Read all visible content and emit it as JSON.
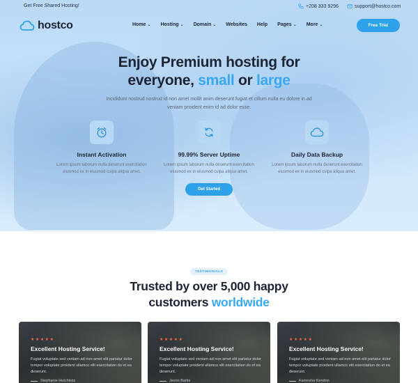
{
  "topbar": {
    "promo": "Get Free Shared Hosting!",
    "phone": "+208 333 9296",
    "email": "support@hostco.com"
  },
  "brand": {
    "name": "hostco",
    "logo_icon": "cloud-icon"
  },
  "nav": {
    "items": [
      {
        "label": "Home",
        "has_dropdown": true
      },
      {
        "label": "Hosting",
        "has_dropdown": true
      },
      {
        "label": "Domain",
        "has_dropdown": true
      },
      {
        "label": "Websites",
        "has_dropdown": false
      },
      {
        "label": "Help",
        "has_dropdown": false
      },
      {
        "label": "Pages",
        "has_dropdown": true
      },
      {
        "label": "More",
        "has_dropdown": true
      }
    ],
    "cta": "Free Trial"
  },
  "hero": {
    "title_line1": "Enjoy Premium hosting for",
    "title_line2_a": "everyone,",
    "title_line2_b": "small",
    "title_line2_c": "or",
    "title_line2_d": "large",
    "subtitle": "Incididunt nostrud nostrud id non amet mollit anim deserunt fugiat et cillum nulla eu dolore in ad veniam proident enim id ad dolor esse.",
    "features": [
      {
        "icon": "clock-icon",
        "title": "Instant Activation",
        "desc": "Lorem ipsum laborum nulla deserunt exercitation eiusmod ex in eiusmod culpa aliqua amet."
      },
      {
        "icon": "refresh-icon",
        "title": "99.99% Server Uptime",
        "desc": "Lorem ipsum laborum nulla deserunt exercitation eiusmod ex in eiusmod culpa aliqua amet."
      },
      {
        "icon": "cloud-icon",
        "title": "Daily Data Backup",
        "desc": "Lorem ipsum laborum nulla deserunt exercitation eiusmod ex in eiusmod culpa aliqua amet."
      }
    ],
    "cta": "Get Started"
  },
  "testimonials": {
    "tag": "TESTIMONIALS",
    "title_line1": "Trusted by over 5,000 happy",
    "title_line2_a": "customers",
    "title_line2_b": "worldwide",
    "cards": [
      {
        "stars": "★★★★★",
        "title": "Excellent Hosting Service!",
        "text": "Fugiat voluptate sed veniam ad non amet elit pariatur dolor tempor voluptate proident ullamco elit exercitation do et ea deserunt.",
        "author": "Stephanie Hutchkiss"
      },
      {
        "stars": "★★★★★",
        "title": "Excellent Hosting Service!",
        "text": "Fugiat voluptate sed veniam ad non amet elit pariatur dolor tempor voluptate proident ullamco elit exercitation do et ea deserunt.",
        "author": "Jevon Barks"
      },
      {
        "stars": "★★★★★",
        "title": "Excellent Hosting Service!",
        "text": "Fugiat voluptate sed veniam ad non amet elit pariatur dolor tempor voluptate proident ullamco elit exercitation do et ea deserunt.",
        "author": "Kamesha Kendon"
      }
    ]
  },
  "colors": {
    "accent": "#2da2ea",
    "text": "#1d2433",
    "star": "#ff6a3d"
  }
}
